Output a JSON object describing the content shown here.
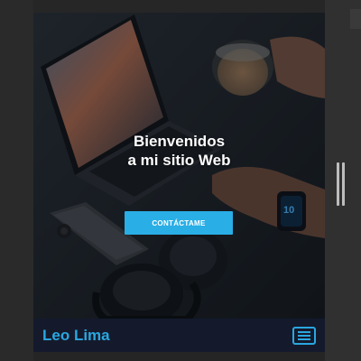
{
  "hero": {
    "title_line1": "Bienvenidos",
    "title_line2": "a mi sitio Web",
    "cta_label": "CONTÁCTAME"
  },
  "navbar": {
    "brand": "Leo Lima",
    "menu_icon": "hamburger-menu-icon"
  },
  "colors": {
    "accent": "#2aa7e0",
    "navbar_bg": "#141a2c",
    "cta_bg": "#2aaee6"
  }
}
